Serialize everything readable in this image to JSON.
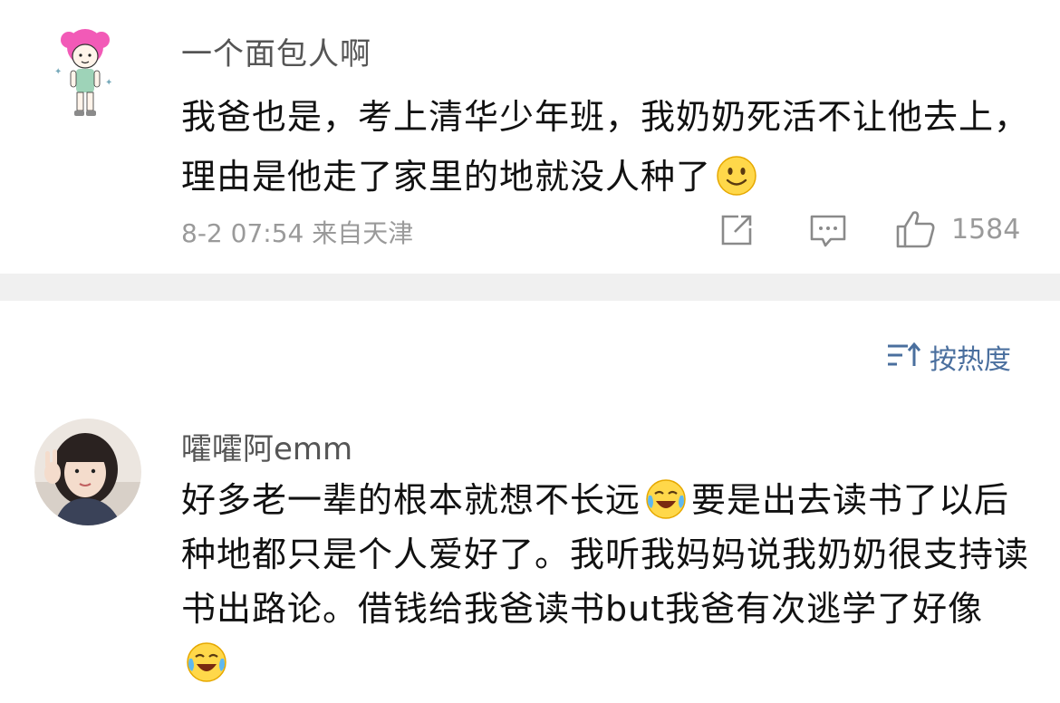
{
  "comments": [
    {
      "user": "一个面包人啊",
      "text_before_emoji": "我爸也是，考上清华少年班，我奶奶死活不让他去上，理由是他走了家里的地就没人种了",
      "emoji": "smile-emoji",
      "time": "8-2 07:54",
      "location": "来自天津",
      "likes": "1584"
    },
    {
      "user": "嚯嚯阿emm",
      "segments": [
        "好多老一辈的根本就想不长远",
        "要是出去读书了以后种地都只是个人爱好了。我听我妈妈说我奶奶很支持读书出路论。借钱给我爸读书but我爸有次逃学了好像"
      ],
      "emoji": "laugh-cry-emoji"
    }
  ],
  "sort": {
    "label": "按热度",
    "icon": "sort-icon"
  },
  "colors": {
    "link_blue": "#4a6f9e",
    "meta_gray": "#9a9a9a",
    "divider": "#f0f0f0"
  }
}
